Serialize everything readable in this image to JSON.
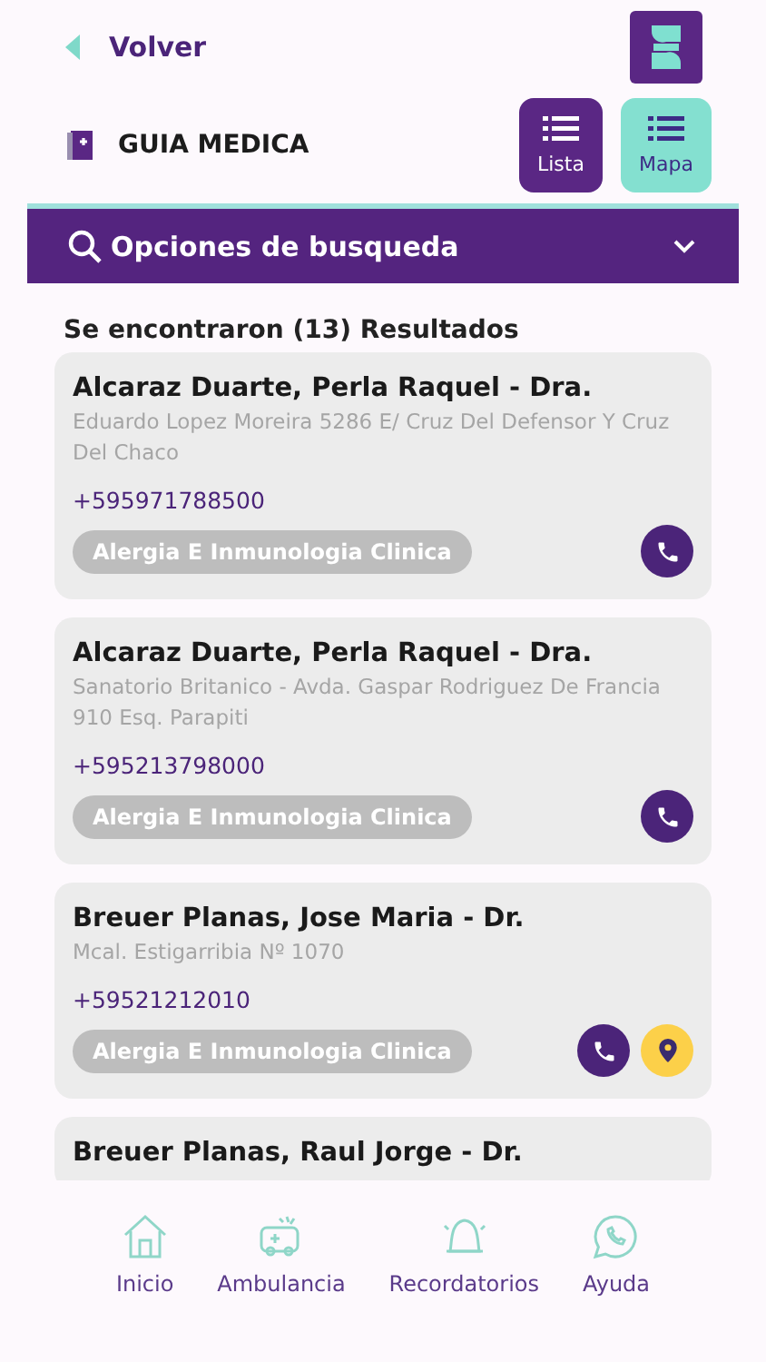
{
  "header": {
    "back_label": "Volver"
  },
  "section": {
    "title": "GUIA MEDICA"
  },
  "view_toggle": [
    {
      "label": "Lista",
      "selected": true
    },
    {
      "label": "Mapa",
      "selected": false
    }
  ],
  "search_bar": {
    "label": "Opciones de busqueda",
    "expanded": false
  },
  "results_summary": "Se encontraron (13) Resultados",
  "results": [
    {
      "name": "Alcaraz Duarte, Perla Raquel - Dra.",
      "address": "Eduardo Lopez Moreira 5286 E/ Cruz Del Defensor Y Cruz Del Chaco",
      "phone": "+595971788500",
      "specialty": "Alergia E Inmunologia Clinica",
      "has_location": false
    },
    {
      "name": "Alcaraz Duarte, Perla Raquel - Dra.",
      "address": "Sanatorio Britanico - Avda. Gaspar Rodriguez De Francia 910 Esq. Parapiti",
      "phone": "+595213798000",
      "specialty": "Alergia E Inmunologia Clinica",
      "has_location": false
    },
    {
      "name": "Breuer Planas, Jose Maria - Dr.",
      "address": "Mcal. Estigarribia Nº 1070",
      "phone": "+59521212010",
      "specialty": "Alergia E Inmunologia Clinica",
      "has_location": true
    },
    {
      "name": "Breuer Planas, Raul Jorge - Dr."
    }
  ],
  "bottom_nav": [
    {
      "label": "Inicio",
      "kind": "home"
    },
    {
      "label": "Ambulancia",
      "kind": "ambulance"
    },
    {
      "label": "Recordatorios",
      "kind": "bell"
    },
    {
      "label": "Ayuda",
      "kind": "chat"
    }
  ]
}
